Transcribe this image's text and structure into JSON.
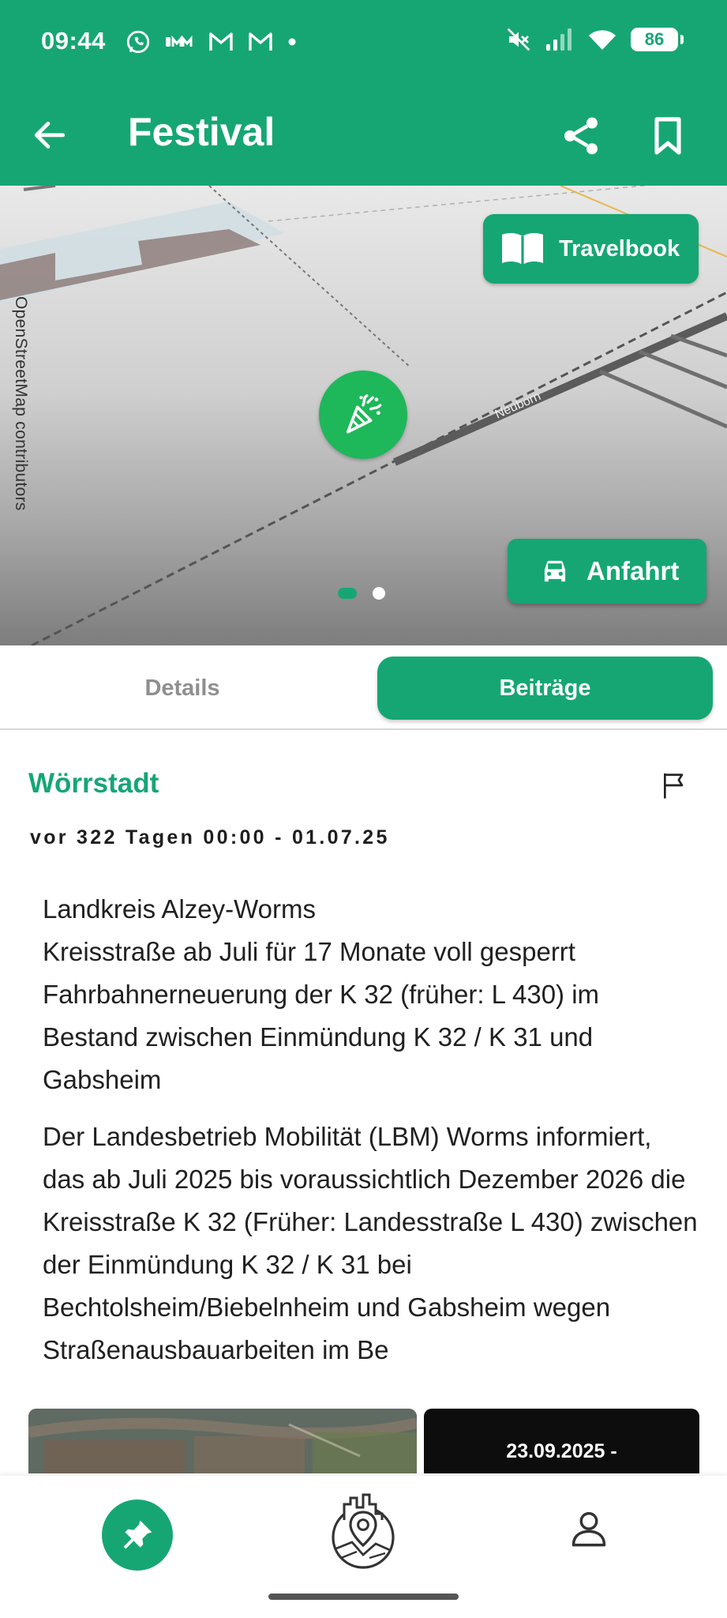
{
  "status_bar": {
    "time": "09:44",
    "battery": "86",
    "left_icons": [
      "whatsapp-icon",
      "carrier-icon",
      "gmail-icon",
      "gmail-icon",
      "dot-icon"
    ],
    "right_icons": [
      "mute-icon",
      "signal-icon",
      "wifi-icon",
      "battery-icon"
    ]
  },
  "app_bar": {
    "title": "Festival",
    "icons": [
      "back-arrow-icon",
      "share-icon",
      "bookmark-icon"
    ]
  },
  "map": {
    "credit": "OpenStreetMap contributors",
    "street_label": "Neuborn",
    "travelbook_label": "Travelbook",
    "anfahrt_label": "Anfahrt",
    "marker_icon": "party-popper-icon",
    "pager": {
      "current": 1,
      "total": 2
    }
  },
  "tabs": {
    "items": [
      {
        "label": "Details",
        "active": false
      },
      {
        "label": "Beiträge",
        "active": true
      }
    ]
  },
  "post": {
    "location": "Wörrstadt",
    "date": "vor 322 Tagen 00:00 - 01.07.25",
    "paragraphs": [
      "Landkreis Alzey-Worms\nKreisstraße ab Juli für 17 Monate voll gesperrt\nFahrbahnerneuerung der K 32 (früher: L 430) im Bestand zwischen Einmündung K 32 / K 31 und Gabsheim",
      "Der Landesbetrieb Mobilität (LBM) Worms informiert, das ab Juli 2025 bis voraussichtlich Dezember 2026 die Kreisstraße K 32 (Früher: Landesstraße L 430) zwischen der Einmündung K 32 / K 31 bei Bechtolsheim/Biebelnheim und Gabsheim wegen Straßenausbauarbeiten im Be"
    ],
    "thumb2_text": "23.09.2025 -"
  },
  "colors": {
    "brand": "#16a674",
    "marker": "#1eb75a"
  },
  "bottom_nav": {
    "icons": [
      "pin-icon",
      "city-map-icon",
      "profile-icon"
    ]
  }
}
